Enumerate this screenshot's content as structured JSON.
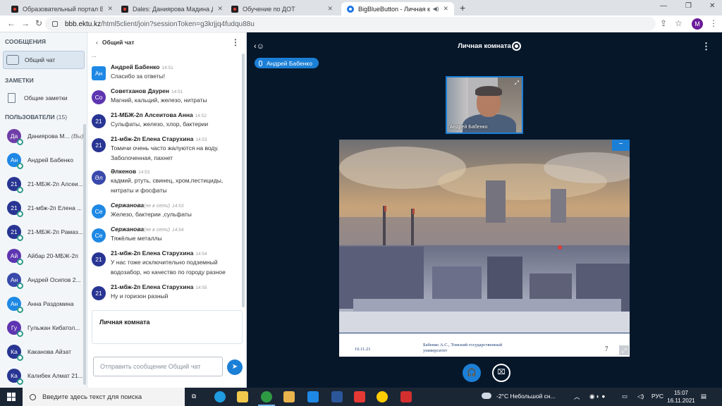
{
  "browser": {
    "tabs": [
      {
        "title": "Образовательный портал ВКГТ",
        "favicon": "d-logo-icon"
      },
      {
        "title": "Dales: Даниярова Мадина Дани",
        "favicon": "d-logo-icon"
      },
      {
        "title": "Обучение по ДОТ",
        "favicon": "d-logo-icon"
      },
      {
        "title": "BigBlueButton - Личная ком",
        "favicon": "bbb-icon",
        "active": true
      }
    ],
    "url_host": "bbb.ektu.kz",
    "url_path": "/html5client/join?sessionToken=g3krjjq4fudqu88u",
    "profile_initial": "M"
  },
  "left_panel": {
    "messages_title": "СООБЩЕНИЯ",
    "public_chat_label": "Общий чат",
    "notes_title": "ЗАМЕТКИ",
    "shared_notes_label": "Общие заметки",
    "users_title": "ПОЛЬЗОВАТЕЛИ",
    "users_count": "(15)",
    "users": [
      {
        "initials": "Да",
        "name": "Даниярова М...",
        "you": "(Вы)",
        "color": "#6f3ea8"
      },
      {
        "initials": "Ан",
        "name": "Андрей Бабенко",
        "color": "#1e88e5"
      },
      {
        "initials": "21",
        "name": "21-МБЖ-2п Алсеи...",
        "color": "#283593"
      },
      {
        "initials": "21",
        "name": "21-мбж-2п Елена ...",
        "color": "#283593"
      },
      {
        "initials": "21",
        "name": "21-МБЖ-2п Рамаз...",
        "color": "#283593"
      },
      {
        "initials": "Ай",
        "name": "Айбар 20-МБЖ-2п",
        "color": "#5e35b1"
      },
      {
        "initials": "Ан",
        "name": "Андрей Осипов 2...",
        "color": "#3949ab"
      },
      {
        "initials": "Ан",
        "name": "Анна Раздомина",
        "color": "#1e88e5"
      },
      {
        "initials": "Гу",
        "name": "Гульжан Кибатол...",
        "color": "#5e35b1"
      },
      {
        "initials": "Ка",
        "name": "Каканова Айзат",
        "color": "#283593"
      },
      {
        "initials": "Ка",
        "name": "Калибек Алмат 21...",
        "color": "#283593"
      }
    ]
  },
  "chat": {
    "header": "Общий чат",
    "cut_line": "...",
    "messages": [
      {
        "initials": "Ан",
        "name": "Андрей Бабенко",
        "time": "14:51",
        "text": "Спасибо за ответы!",
        "color": "#1e88e5",
        "square": true
      },
      {
        "initials": "Со",
        "name": "Советханов Даурен",
        "time": "14:51",
        "text": "Магний, кальций, железо, нитраты",
        "color": "#5e35b1"
      },
      {
        "initials": "21",
        "name": "21-МБЖ-2п Алсеитова Анна",
        "time": "14:52",
        "text": "Сульфаты, железо, хлор, бактерии",
        "color": "#283593"
      },
      {
        "initials": "21",
        "name": "21-мбж-2п Елена Старухина",
        "time": "14:53",
        "text": "Томичи очень часто жалуются на воду. Заболоченная, пахнет",
        "color": "#283593"
      },
      {
        "initials": "Әл",
        "name": "Әлкенов",
        "time": "14:53",
        "text": "кадмий, ртуть, свинец, хром,пестициды, нитраты и фосфаты",
        "color": "#3949ab"
      },
      {
        "initials": "Се",
        "name": "Сержанова",
        "offline": "(не в сети)",
        "time": "14:53",
        "text": "Железо, бактерии ,сульфаты",
        "color": "#1e88e5",
        "italic": true
      },
      {
        "initials": "Се",
        "name": "Сержанова",
        "offline": "(не в сети)",
        "time": "14:54",
        "text": "Тяжёлые металлы",
        "color": "#1e88e5",
        "italic": true
      },
      {
        "initials": "21",
        "name": "21-мбж-2п Елена Старухина",
        "time": "14:54",
        "text": "У нас тоже исключительно подземный водозабор, но качество по городу разное",
        "color": "#283593"
      },
      {
        "initials": "21",
        "name": "21-мбж-2п Елена Старухина",
        "time": "14:55",
        "text": "Ну и горизон разный",
        "color": "#283593"
      }
    ],
    "typing_room": "Личная комната",
    "input_placeholder": "Отправить сообщение Общий чат"
  },
  "stage": {
    "title": "Личная комната",
    "talking": "Андрей Бабенко",
    "webcam_name": "Андрей Бабенко",
    "slide_date": "16.11.21",
    "slide_author": "Бабенко А.С., Томский государственный университет",
    "slide_number": "7"
  },
  "taskbar": {
    "search_placeholder": "Введите здесь текст для поиска",
    "weather": "-2°C  Небольшой сн...",
    "lang": "РУС",
    "time": "15:07",
    "date": "16.11.2021"
  }
}
